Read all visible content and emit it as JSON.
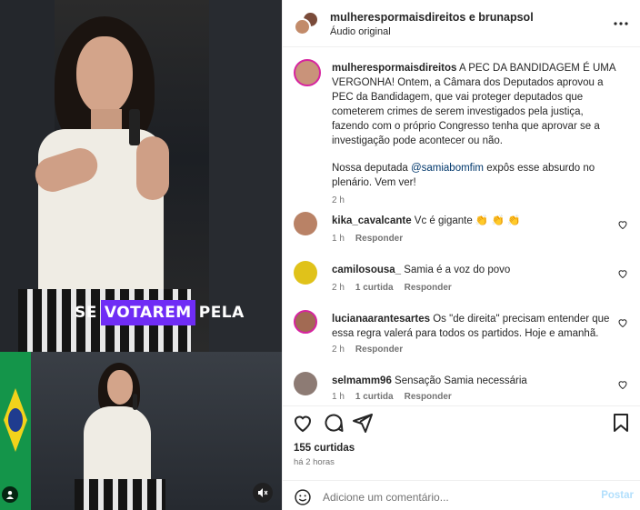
{
  "media": {
    "caption_plain": "SE ",
    "caption_highlight": "VOTAREM",
    "caption_rest": " PELA"
  },
  "header": {
    "title": "mulherespormaisdireitos e brunapsol",
    "subtitle": "Áudio original"
  },
  "caption": {
    "username": "mulherespormaisdireitos",
    "text_part1": " A PEC DA BANDIDAGEM É UMA VERGONHA! Ontem, a Câmara dos Deputados aprovou a PEC da Bandidagem, que vai proteger deputados que cometerem crimes de serem investigados pela justiça, fazendo com o próprio Congresso tenha que aprovar se a investigação pode acontecer ou não.",
    "text_part2_pre": "Nossa deputada ",
    "mention": "@samiabomfim",
    "text_part2_post": " expôs esse absurdo no plenário. Vem ver!",
    "time": "2 h"
  },
  "comments": [
    {
      "username": "kika_cavalcante",
      "text": " Vc é gigante 👏 👏 👏",
      "time": "1 h",
      "reply": "Responder",
      "likes": ""
    },
    {
      "username": "camilosousa_",
      "text": " Samia é a voz do povo",
      "time": "2 h",
      "likes": "1 curtida",
      "reply": "Responder"
    },
    {
      "username": "lucianaarantesartes",
      "text": " Os \"de direita\" precisam entender que essa regra valerá para todos os partidos. Hoje e amanhã.",
      "time": "2 h",
      "reply": "Responder",
      "likes": ""
    },
    {
      "username": "selmamm96",
      "text": " Sensação Samia necessária",
      "time": "1 h",
      "likes": "1 curtida",
      "reply": "Responder"
    }
  ],
  "footer": {
    "likes": "155 curtidas",
    "time": "há 2 horas",
    "comment_placeholder": "Adicione um comentário...",
    "post_label": "Postar"
  },
  "colors": {
    "caption_highlight": "#6f2cf5",
    "mention": "#00376b",
    "post_disabled": "#b2dffc"
  },
  "icons": [
    "heart-icon",
    "comment-icon",
    "share-icon",
    "bookmark-icon",
    "more-icon",
    "mute-icon",
    "user-tag-icon",
    "emoji-icon"
  ]
}
